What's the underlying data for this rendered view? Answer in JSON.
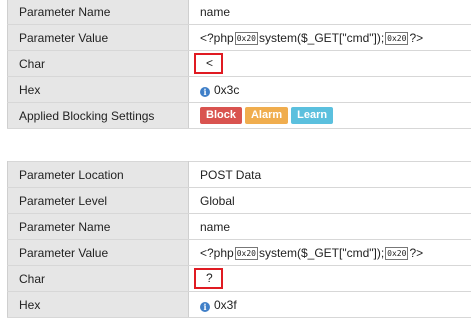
{
  "table1": {
    "rows": [
      {
        "label": "Parameter Name",
        "value": "name"
      },
      {
        "label": "Parameter Value",
        "value_parts": [
          "<?php",
          "0x20",
          "system($_GET[\"cmd\"]);",
          "0x20",
          "?>"
        ]
      },
      {
        "label": "Char",
        "value": "<"
      },
      {
        "label": "Hex",
        "value": "0x3c"
      },
      {
        "label": "Applied Blocking Settings"
      }
    ],
    "badges": [
      {
        "label": "Block",
        "color": "#d9534f"
      },
      {
        "label": "Alarm",
        "color": "#f0ad4e"
      },
      {
        "label": "Learn",
        "color": "#5bc0de"
      }
    ]
  },
  "table2": {
    "rows": [
      {
        "label": "Parameter Location",
        "value": "POST Data"
      },
      {
        "label": "Parameter Level",
        "value": "Global"
      },
      {
        "label": "Parameter Name",
        "value": "name"
      },
      {
        "label": "Parameter Value",
        "value_parts": [
          "<?php",
          "0x20",
          "system($_GET[\"cmd\"]);",
          "0x20",
          "?>"
        ]
      },
      {
        "label": "Char",
        "value": "?"
      },
      {
        "label": "Hex",
        "value": "0x3f"
      }
    ]
  },
  "icons": {
    "info": "info-icon",
    "info_glyph": "i"
  },
  "highlight_color": "#e01b22"
}
